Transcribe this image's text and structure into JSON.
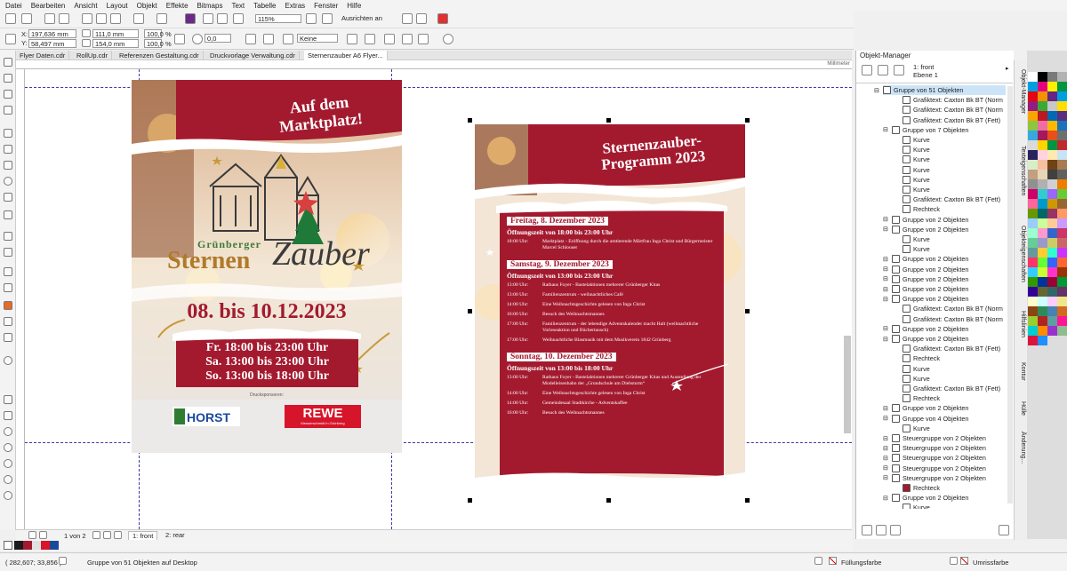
{
  "menu": [
    "Datei",
    "Bearbeiten",
    "Ansicht",
    "Layout",
    "Objekt",
    "Effekte",
    "Bitmaps",
    "Text",
    "Tabelle",
    "Extras",
    "Fenster",
    "Hilfe"
  ],
  "toolbar": {
    "zoom": "115%",
    "align_label": "Ausrichten an"
  },
  "properties": {
    "x_label": "X:",
    "x_value": "197,636 mm",
    "y_label": "Y:",
    "y_value": "58,497 mm",
    "w_value": "111,0 mm",
    "h_value": "154,0 mm",
    "scale_x": "100,0",
    "scale_y": "100,0",
    "pct": "%",
    "rotation": "0,0",
    "outline": "Keine"
  },
  "tabs": [
    "Flyer Daten.cdr",
    "RollUp.cdr",
    "Referenzen Gestaltung.cdr",
    "Druckvorlage Verwaltung.cdr",
    "Sternenzauber A6 Flyer..."
  ],
  "ruler": {
    "unit": "Millimeter"
  },
  "flyer1": {
    "headline_l1": "Auf dem",
    "headline_l2": "Marktplatz!",
    "logo_small": "Grünberger",
    "logo_big1": "Sternen",
    "logo_big2": "Zauber",
    "dates": "08. bis 10.12.2023",
    "times": [
      "Fr. 18:00 bis 23:00 Uhr",
      "Sa. 13:00 bis 23:00 Uhr",
      "So. 13:00 bis 18:00 Uhr"
    ],
    "sponsors_label": "Drucksponsoren:",
    "sponsor1": "HORST",
    "sponsor2": "REWE",
    "sponsor2_sub": "Messerschmidt in Grünberg"
  },
  "flyer2": {
    "title_l1": "Sternenzauber-",
    "title_l2": "Programm 2023",
    "days": [
      {
        "title": "Freitag, 8. Dezember 2023",
        "hours": "Öffnungszeit von 18:00 bis 23:00 Uhr",
        "items": [
          {
            "time": "18:00 Uhr:",
            "text": "Marktplatz - Eröffnung durch die amtierende Märtfrau Inga Christ und Bürgermeister Marcel Schlouser"
          }
        ]
      },
      {
        "title": "Samstag, 9. Dezember 2023",
        "hours": "Öffnungszeit von 13:00 bis 23:00 Uhr",
        "items": [
          {
            "time": "13:00 Uhr:",
            "text": "Rathaus Foyer - Bastelaktionen mehrerer Grünberger Kitas"
          },
          {
            "time": "13:00 Uhr:",
            "text": "Familienzentrum - weihnachtliches Café"
          },
          {
            "time": "14:00 Uhr:",
            "text": "Eine Weihnachtsgeschichte gelesen von Inga Christ"
          },
          {
            "time": "16:00 Uhr:",
            "text": "Besuch des Weihnachtsmannes"
          },
          {
            "time": "17:00 Uhr:",
            "text": "Familienzentrum - der lebendige Adventskalender macht Halt (weihnachtliche Vorleseaktion und Büchertausch)"
          },
          {
            "time": "17:00 Uhr:",
            "text": "Weihnachtliche Blasmusik mit dem Musikverein 1842 Grünberg"
          }
        ]
      },
      {
        "title": "Sonntag, 10. Dezember 2023",
        "hours": "Öffnungszeit von 13:00 bis 18:00 Uhr",
        "items": [
          {
            "time": "13:00 Uhr:",
            "text": "Rathaus Foyer - Bastelaktionen mehrerer Grünberger Kitas und Ausstellung der Modelleisenbahn der „Grundschule am Diebsturm“"
          },
          {
            "time": "14:00 Uhr:",
            "text": "Eine Weihnachtsgeschichte gelesen von Inga Christ"
          },
          {
            "time": "14:00 Uhr:",
            "text": "Gemeindesaal Stadtkirche - Adventskaffee"
          },
          {
            "time": "16:00 Uhr:",
            "text": "Besuch des Weihnachtsmannes"
          }
        ]
      }
    ]
  },
  "pages": {
    "counter": "1 von 2",
    "page1": "1: front",
    "page2": "2: rear"
  },
  "status": {
    "coords": "( 282,607; 33,856 )",
    "selection": "Gruppe von 51 Objekten auf Desktop",
    "fill_label": "Füllungsfarbe",
    "outline_label": "Umrissfarbe"
  },
  "object_manager": {
    "title": "Objekt-Manager",
    "layer_page": "1: front",
    "layer": "Ebene 1",
    "items": [
      "Gruppe von 51 Objekten",
      "Grafiktext: Caxton Bk BT (Norm",
      "Grafiktext: Caxton Bk BT (Norm",
      "Grafiktext: Caxton Bk BT (Fett)",
      "Gruppe von 7 Objekten",
      "Kurve",
      "Kurve",
      "Kurve",
      "Kurve",
      "Kurve",
      "Kurve",
      "Grafiktext: Caxton Bk BT (Fett)",
      "Rechteck",
      "Gruppe von 2 Objekten",
      "Gruppe von 2 Objekten",
      "Kurve",
      "Kurve",
      "Gruppe von 2 Objekten",
      "Gruppe von 2 Objekten",
      "Gruppe von 2 Objekten",
      "Gruppe von 2 Objekten",
      "Gruppe von 2 Objekten",
      "Grafiktext: Caxton Bk BT (Norm",
      "Grafiktext: Caxton Bk BT (Norm",
      "Gruppe von 2 Objekten",
      "Gruppe von 2 Objekten",
      "Grafiktext: Caxton Bk BT (Fett)",
      "Rechteck",
      "Kurve",
      "Kurve",
      "Grafiktext: Caxton Bk BT (Fett)",
      "Rechteck",
      "Gruppe von 2 Objekten",
      "Gruppe von 4 Objekten",
      "Kurve",
      "Steuergruppe von 2 Objekten",
      "Steuergruppe von 2 Objekten",
      "Steuergruppe von 2 Objekten",
      "Steuergruppe von 2 Objekten",
      "Steuergruppe von 2 Objekten",
      "Rechteck",
      "Gruppe von 2 Objekten",
      "Kurve"
    ]
  },
  "dock_tabs": [
    "Objekt-Manager",
    "Texteigenschaften",
    "Objekteigenschaften",
    "Hilfslinien",
    "Kontur",
    "Hülle",
    "Änderung..."
  ],
  "colors": {
    "brand_red": "#a31a2f",
    "gold": "#b07a2a",
    "selection": "#cce4f7",
    "palette": [
      "#ffffff",
      "#000000",
      "#7a7a7a",
      "#b3b3b3",
      "#00a0e0",
      "#e4007f",
      "#ffef00",
      "#00963f",
      "#e30613",
      "#f39200",
      "#662483",
      "#009fe3",
      "#951b81",
      "#3aaa35",
      "#c8c8c8",
      "#ffde00",
      "#f7a600",
      "#be1622",
      "#0069b4",
      "#5a2d81",
      "#8dc63f",
      "#ed6ea7",
      "#fbba00",
      "#1d71b8",
      "#36a9e1",
      "#a3195b",
      "#e94e1b",
      "#6f6f6e",
      "#dadada",
      "#ffd500",
      "#009640",
      "#c1272d",
      "#29235c",
      "#ffd3e0",
      "#ffe9b3",
      "#c7e3f5",
      "#d9edc8",
      "#f5c0a0",
      "#704214",
      "#a67c52",
      "#c0a080",
      "#e8d5b5",
      "#404040",
      "#606060",
      "#909090",
      "#b0b0b0",
      "#d0d0d0",
      "#ef7d00",
      "#cc0066",
      "#33cccc",
      "#9966ff",
      "#66cc33",
      "#ff6699",
      "#0099cc",
      "#cc9900",
      "#996633",
      "#669900",
      "#006666",
      "#993366",
      "#ff9966",
      "#99ccff",
      "#ccff99",
      "#ffcc99",
      "#cc99ff",
      "#99ffcc",
      "#ff99cc",
      "#3366cc",
      "#cc3366",
      "#66cc99",
      "#9999cc",
      "#cccc66",
      "#cc6666",
      "#669999",
      "#ffcc33",
      "#33ffcc",
      "#cc33ff",
      "#ff3366",
      "#66ff33",
      "#3366ff",
      "#ff6633",
      "#33ccff",
      "#ccff33",
      "#ff33cc",
      "#993300",
      "#339900",
      "#003399",
      "#990033",
      "#009933",
      "#330099",
      "#666633",
      "#336666",
      "#663366",
      "#ffffcc",
      "#ccffff",
      "#ffccff",
      "#f0e68c",
      "#8b4513",
      "#2e8b57",
      "#4682b4",
      "#d2691e",
      "#9acd32",
      "#b22222",
      "#5f9ea0",
      "#ff1493",
      "#00ced1",
      "#ff8c00",
      "#9932cc",
      "#8fbc8f",
      "#dc143c",
      "#1e90ff"
    ]
  }
}
